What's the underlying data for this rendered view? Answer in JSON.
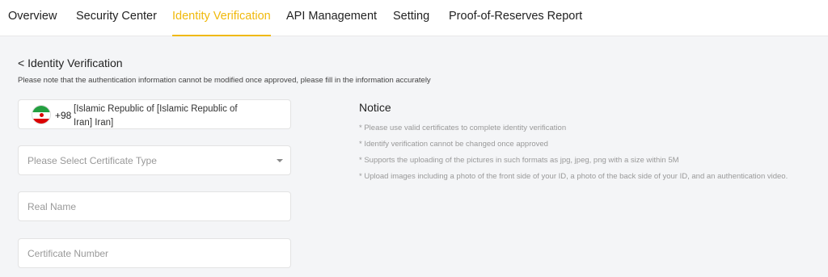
{
  "nav": {
    "tabs": [
      "Overview",
      "Security Center",
      "Identity Verification",
      "API Management",
      "Setting",
      "Proof-of-Reserves Report"
    ],
    "active": "Identity Verification"
  },
  "page": {
    "back_title": "< Identity Verification",
    "note": "Please note that the authentication information cannot be modified once approved, please fill in the information accurately"
  },
  "phone": {
    "flag": "iran-flag-icon",
    "code": "+98",
    "country_line1": "[Islamic Republic of [Islamic Republic of",
    "country_line2": "Iran] Iran]"
  },
  "form": {
    "certificate_type_placeholder": "Please Select Certificate Type",
    "real_name_placeholder": "Real Name",
    "certificate_number_placeholder": "Certificate Number"
  },
  "notice": {
    "title": "Notice",
    "items": [
      "* Please use valid certificates to complete identity verification",
      "* Identify verification cannot be changed once approved",
      "* Supports the uploading of the pictures in such formats as jpg, jpeg, png with a size within 5M",
      "* Upload images including a photo of the front side of your ID, a photo of the back side of your ID, and an authentication video."
    ]
  },
  "colors": {
    "accent": "#f0b90b"
  }
}
